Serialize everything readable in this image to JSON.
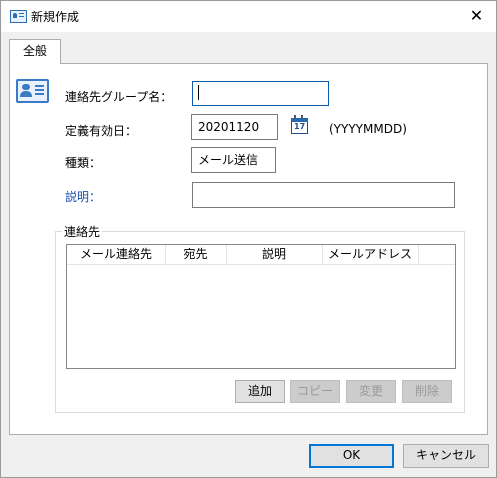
{
  "window": {
    "title": "新規作成",
    "close_glyph": "✕"
  },
  "tabs": [
    {
      "label": "全般"
    }
  ],
  "form": {
    "group_name_label": "連絡先グループ名：",
    "group_name_value": "",
    "expiry_label": "定義有効日：",
    "expiry_value": "20201120",
    "expiry_format_hint": "(YYYYMMDD)",
    "type_label": "種類：",
    "type_value": "メール送信",
    "description_label": "説明：",
    "description_value": ""
  },
  "contacts": {
    "group_label": "連絡先",
    "columns": [
      "メール連絡先",
      "宛先",
      "説明",
      "メールアドレス"
    ],
    "rows": [],
    "buttons": {
      "add": "追加",
      "copy": "コピー",
      "edit": "変更",
      "delete": "削除"
    }
  },
  "footer": {
    "ok": "OK",
    "cancel": "キャンセル"
  },
  "icons": {
    "title": "contact-card-icon",
    "form": "contact-card-icon",
    "calendar": "calendar-icon",
    "close": "close-icon"
  },
  "colors": {
    "accent": "#0078d7",
    "link_label": "#1a4fb3",
    "window_bg": "#f0f0f0"
  }
}
